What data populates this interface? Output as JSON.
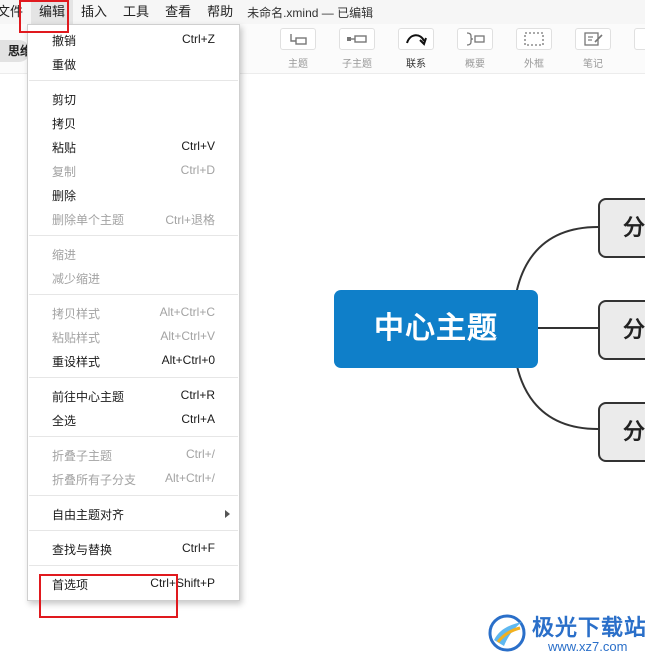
{
  "menubar": {
    "items": [
      "文件",
      "编辑",
      "插入",
      "工具",
      "查看",
      "帮助"
    ],
    "document_title": "未命名.xmind — 已编辑"
  },
  "toolbar": {
    "mode_tab": "思维",
    "tools": [
      "主题",
      "子主题",
      "联系",
      "概要",
      "外框",
      "笔记"
    ]
  },
  "edit_menu": {
    "items": [
      {
        "label": "撤销",
        "shortcut": "Ctrl+Z",
        "enabled": true
      },
      {
        "label": "重做",
        "shortcut": "",
        "enabled": true
      },
      {
        "label": "剪切",
        "shortcut": "",
        "enabled": true
      },
      {
        "label": "拷贝",
        "shortcut": "",
        "enabled": true
      },
      {
        "label": "粘贴",
        "shortcut": "Ctrl+V",
        "enabled": true
      },
      {
        "label": "复制",
        "shortcut": "Ctrl+D",
        "enabled": false
      },
      {
        "label": "删除",
        "shortcut": "",
        "enabled": true
      },
      {
        "label": "删除单个主题",
        "shortcut": "Ctrl+退格",
        "enabled": false
      },
      {
        "label": "缩进",
        "shortcut": "",
        "enabled": false
      },
      {
        "label": "减少缩进",
        "shortcut": "",
        "enabled": false
      },
      {
        "label": "拷贝样式",
        "shortcut": "Alt+Ctrl+C",
        "enabled": false
      },
      {
        "label": "粘贴样式",
        "shortcut": "Alt+Ctrl+V",
        "enabled": false
      },
      {
        "label": "重设样式",
        "shortcut": "Alt+Ctrl+0",
        "enabled": true
      },
      {
        "label": "前往中心主题",
        "shortcut": "Ctrl+R",
        "enabled": true
      },
      {
        "label": "全选",
        "shortcut": "Ctrl+A",
        "enabled": true
      },
      {
        "label": "折叠子主题",
        "shortcut": "Ctrl+/",
        "enabled": false
      },
      {
        "label": "折叠所有子分支",
        "shortcut": "Alt+Ctrl+/",
        "enabled": false
      },
      {
        "label": "自由主题对齐",
        "shortcut": "",
        "enabled": true,
        "submenu": true
      },
      {
        "label": "查找与替换",
        "shortcut": "Ctrl+F",
        "enabled": true
      },
      {
        "label": "首选项",
        "shortcut": "Ctrl+Shift+P",
        "enabled": true
      }
    ]
  },
  "mindmap": {
    "central_topic": "中心主题",
    "branches": [
      "分",
      "分",
      "分"
    ]
  },
  "watermark": {
    "name": "极光下载站",
    "url": "www.xz7.com"
  },
  "colors": {
    "central_topic_bg": "#0f7fc9",
    "highlight_border": "#e0191e",
    "watermark_blue": "#2a6fc9"
  }
}
